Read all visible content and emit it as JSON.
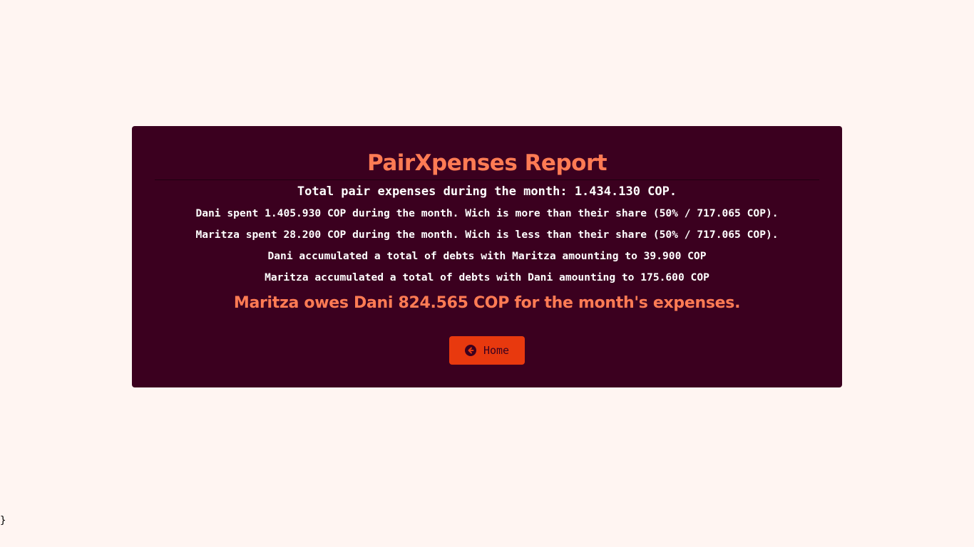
{
  "report": {
    "title": "PairXpenses Report",
    "total_line": "Total pair expenses during the month: 1.434.130 COP.",
    "lines": [
      "Dani spent 1.405.930 COP during the month. Wich is more than their share (50% / 717.065 COP).",
      "Maritza spent 28.200 COP during the month. Wich is less than their share (50% / 717.065 COP).",
      "Dani accumulated a total of debts with Maritza amounting to 39.900 COP",
      "Maritza accumulated a total of debts with Dani amounting to 175.600 COP"
    ],
    "conclusion": "Maritza owes Dani 824.565 COP for the month's expenses.",
    "home_button": {
      "label": "Home",
      "icon": "arrow-circle-left-icon"
    }
  },
  "stray_text": "}",
  "colors": {
    "page_background": "#fff5f2",
    "card_background": "#3b001f",
    "accent": "#ff7b54",
    "button": "#e8390e",
    "text": "#ffffff"
  }
}
